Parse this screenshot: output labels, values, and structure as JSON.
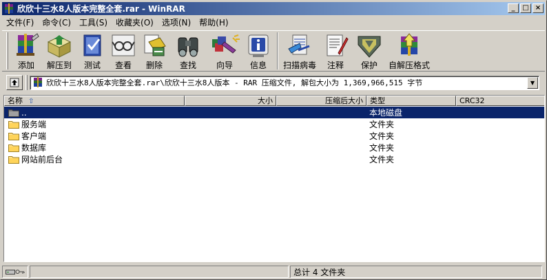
{
  "window": {
    "title": "欣欣十三水8人版本完整全套.rar - WinRAR",
    "minimize": "_",
    "maximize": "□",
    "close": "×"
  },
  "menu": [
    "文件(F)",
    "命令(C)",
    "工具(S)",
    "收藏夹(O)",
    "选项(N)",
    "帮助(H)"
  ],
  "toolbar": [
    {
      "label": "添加",
      "icon": "add-archive-icon"
    },
    {
      "label": "解压到",
      "icon": "extract-to-icon"
    },
    {
      "label": "测试",
      "icon": "test-icon"
    },
    {
      "label": "查看",
      "icon": "view-icon"
    },
    {
      "label": "删除",
      "icon": "delete-icon"
    },
    {
      "label": "查找",
      "icon": "find-icon"
    },
    {
      "label": "向导",
      "icon": "wizard-icon"
    },
    {
      "label": "信息",
      "icon": "info-icon"
    },
    {
      "label": "扫描病毒",
      "icon": "virus-scan-icon"
    },
    {
      "label": "注释",
      "icon": "comment-icon"
    },
    {
      "label": "保护",
      "icon": "protect-icon"
    },
    {
      "label": "自解压格式",
      "icon": "sfx-icon"
    }
  ],
  "address": {
    "path": "欣欣十三水8人版本完整全套.rar\\欣欣十三水8人版本 - RAR 压缩文件, 解包大小为 1,369,966,515 字节"
  },
  "columns": {
    "name": "名称",
    "size": "大小",
    "packed": "压缩后大小",
    "type": "类型",
    "crc": "CRC32"
  },
  "files": [
    {
      "name": "..",
      "type": "本地磁盘",
      "selected": true
    },
    {
      "name": "服务端",
      "type": "文件夹"
    },
    {
      "name": "客户端",
      "type": "文件夹"
    },
    {
      "name": "数据库",
      "type": "文件夹"
    },
    {
      "name": "网站前后台",
      "type": "文件夹"
    }
  ],
  "status": {
    "summary": "总计 4 文件夹"
  }
}
